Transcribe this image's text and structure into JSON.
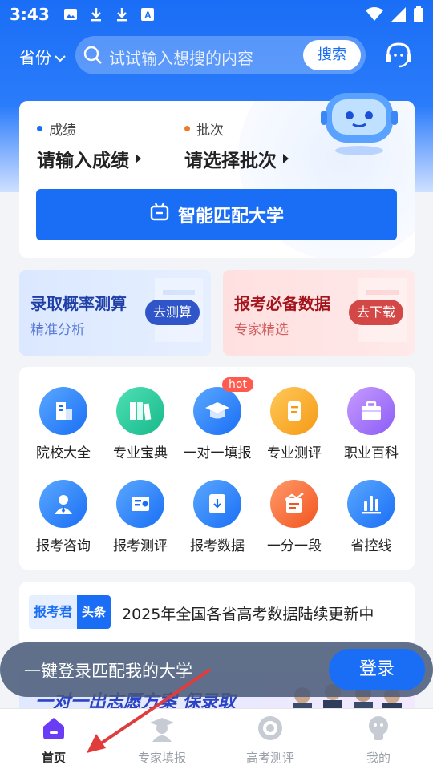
{
  "status_bar": {
    "time": "3:43"
  },
  "header": {
    "province_label": "省份",
    "search_placeholder": "试试输入想搜的内容",
    "search_button": "搜索"
  },
  "match_card": {
    "score_label": "成绩",
    "score_value": "请输入成绩",
    "batch_label": "批次",
    "batch_value": "请选择批次",
    "match_button": "智能匹配大学"
  },
  "promos": [
    {
      "title": "录取概率测算",
      "subtitle": "精准分析",
      "button": "去测算"
    },
    {
      "title": "报考必备数据",
      "subtitle": "专家精选",
      "button": "去下载"
    }
  ],
  "grid": [
    {
      "label": "院校大全",
      "icon": "school-icon"
    },
    {
      "label": "专业宝典",
      "icon": "books-icon"
    },
    {
      "label": "一对一填报",
      "icon": "graduation-cap-icon",
      "badge": "hot"
    },
    {
      "label": "专业测评",
      "icon": "scroll-icon"
    },
    {
      "label": "职业百科",
      "icon": "briefcase-icon"
    },
    {
      "label": "报考咨询",
      "icon": "advisor-icon"
    },
    {
      "label": "报考测评",
      "icon": "assessment-icon"
    },
    {
      "label": "报考数据",
      "icon": "download-folder-icon"
    },
    {
      "label": "一分一段",
      "icon": "score-chart-icon"
    },
    {
      "label": "省控线",
      "icon": "bar-chart-icon"
    }
  ],
  "news": {
    "tag_a": "报考君",
    "tag_b": "头条",
    "text": "2025年全国各省高考数据陆续更新中"
  },
  "banner": {
    "text": "一对一出志愿方案 保录取"
  },
  "login_bar": {
    "text": "一键登录匹配我的大学",
    "button": "登录"
  },
  "tabs": [
    {
      "label": "首页",
      "icon": "home-icon",
      "active": true
    },
    {
      "label": "专家填报",
      "icon": "expert-icon"
    },
    {
      "label": "高考测评",
      "icon": "evaluation-icon"
    },
    {
      "label": "我的",
      "icon": "profile-icon"
    }
  ],
  "colors": {
    "primary": "#1a6ef5",
    "hot_badge": "#ff5a4e",
    "annotation_arrow": "#e23b3b"
  }
}
